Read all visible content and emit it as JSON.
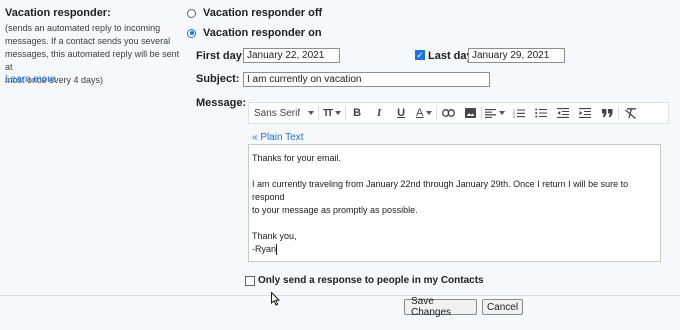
{
  "left": {
    "title": "Vacation responder:",
    "desc_lines": [
      "(sends an automated reply to incoming",
      "messages. If a contact sends you several",
      "messages, this automated reply will be sent at",
      "most once every 4 days)"
    ],
    "learn_more": "Learn more"
  },
  "responder": {
    "off_label": "Vacation responder off",
    "on_label": "Vacation responder on",
    "selected": "on"
  },
  "dates": {
    "first_day_label": "First day:",
    "first_day_value": "January 22, 2021",
    "last_day_label": "Last day:",
    "last_day_value": "January 29, 2021",
    "last_day_checked": true
  },
  "subject": {
    "label": "Subject:",
    "value": "I am currently on vacation"
  },
  "message": {
    "label": "Message:",
    "toolbar": {
      "font": "Sans Serif",
      "icons": [
        "chevron-down-icon",
        "text-size-icon",
        "bold-icon",
        "italic-icon",
        "underline-icon",
        "text-color-icon",
        "link-icon",
        "image-icon",
        "align-icon",
        "numbered-list-icon",
        "bulleted-list-icon",
        "indent-less-icon",
        "indent-more-icon",
        "quote-icon",
        "remove-formatting-icon"
      ],
      "bold": "B",
      "italic": "I",
      "underline": "U",
      "text_color": "A",
      "text_size": "TT"
    },
    "plain_text_link": "« Plain Text",
    "body": {
      "line1": "Thanks for your email.",
      "line2": "I am currently traveling from January 22nd through January 29th. Once I return I will be sure to respond",
      "line3": "to your message as promptly as possible.",
      "line4": "Thank you,",
      "line5": "-Ryan"
    }
  },
  "contacts_only": {
    "label": "Only send a response to people in my Contacts",
    "checked": false
  },
  "buttons": {
    "save": "Save Changes",
    "cancel": "Cancel"
  },
  "colors": {
    "accent": "#1a73e8",
    "background": "#f6f8fc"
  }
}
